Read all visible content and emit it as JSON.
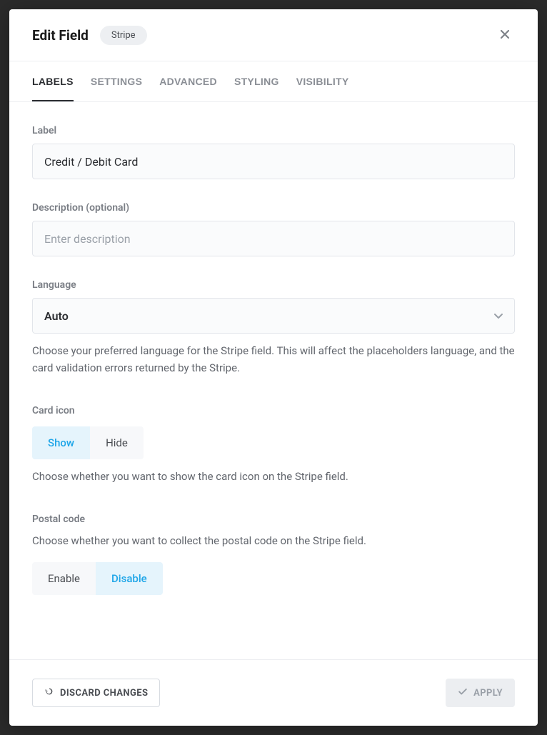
{
  "header": {
    "title": "Edit Field",
    "badge": "Stripe"
  },
  "tabs": [
    {
      "label": "LABELS",
      "active": true
    },
    {
      "label": "SETTINGS",
      "active": false
    },
    {
      "label": "ADVANCED",
      "active": false
    },
    {
      "label": "STYLING",
      "active": false
    },
    {
      "label": "VISIBILITY",
      "active": false
    }
  ],
  "fields": {
    "label": {
      "title": "Label",
      "value": "Credit / Debit Card"
    },
    "description": {
      "title": "Description (optional)",
      "placeholder": "Enter description",
      "value": ""
    },
    "language": {
      "title": "Language",
      "selected": "Auto",
      "help": "Choose your preferred language for the Stripe field. This will affect the placeholders language, and the card validation errors returned by the Stripe."
    },
    "card_icon": {
      "title": "Card icon",
      "options": {
        "show": "Show",
        "hide": "Hide"
      },
      "selected": "show",
      "help": "Choose whether you want to show the card icon on the Stripe field."
    },
    "postal_code": {
      "title": "Postal code",
      "help": "Choose whether you want to collect the postal code on the Stripe field.",
      "options": {
        "enable": "Enable",
        "disable": "Disable"
      },
      "selected": "disable"
    }
  },
  "footer": {
    "discard": "DISCARD CHANGES",
    "apply": "APPLY"
  }
}
